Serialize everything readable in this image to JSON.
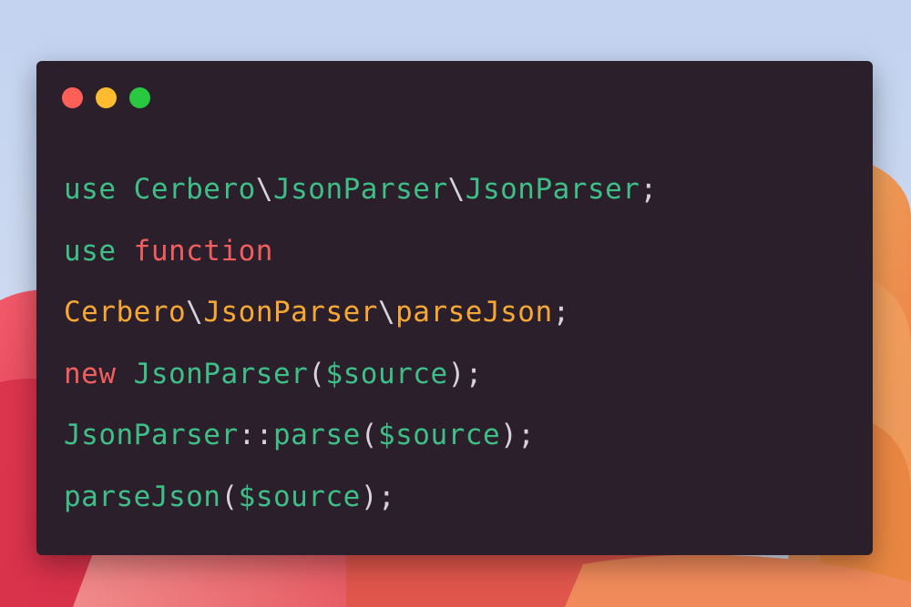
{
  "window": {
    "background": "#2b1f2c",
    "traffic_lights": [
      {
        "name": "close",
        "color": "#ff5f57"
      },
      {
        "name": "minimize",
        "color": "#febc2e"
      },
      {
        "name": "zoom",
        "color": "#28c840"
      }
    ]
  },
  "colors": {
    "keyword": "#3ebf86",
    "namespace": "#3ebf86",
    "function_keyword": "#f05e5e",
    "import_path": "#f7a833",
    "new_keyword": "#f05e5e",
    "variable": "#3ebf86",
    "punctuation": "#d8d2dc"
  },
  "code": {
    "lines": [
      [
        {
          "text": "use ",
          "color": "#3ebf86"
        },
        {
          "text": "Cerbero",
          "color": "#3ebf86"
        },
        {
          "text": "\\",
          "color": "#d8d2dc"
        },
        {
          "text": "JsonParser",
          "color": "#3ebf86"
        },
        {
          "text": "\\",
          "color": "#d8d2dc"
        },
        {
          "text": "JsonParser",
          "color": "#3ebf86"
        },
        {
          "text": ";",
          "color": "#d8d2dc"
        }
      ],
      [
        {
          "text": "use ",
          "color": "#3ebf86"
        },
        {
          "text": "function",
          "color": "#f05e5e"
        }
      ],
      [
        {
          "text": "Cerbero",
          "color": "#f7a833"
        },
        {
          "text": "\\",
          "color": "#d8d2dc"
        },
        {
          "text": "JsonParser",
          "color": "#f7a833"
        },
        {
          "text": "\\",
          "color": "#d8d2dc"
        },
        {
          "text": "parseJson",
          "color": "#f7a833"
        },
        {
          "text": ";",
          "color": "#d8d2dc"
        }
      ],
      [
        {
          "text": "new ",
          "color": "#f05e5e"
        },
        {
          "text": "JsonParser",
          "color": "#3ebf86"
        },
        {
          "text": "(",
          "color": "#d8d2dc"
        },
        {
          "text": "$source",
          "color": "#3ebf86"
        },
        {
          "text": ");",
          "color": "#d8d2dc"
        }
      ],
      [
        {
          "text": "JsonParser",
          "color": "#3ebf86"
        },
        {
          "text": "::",
          "color": "#d8d2dc"
        },
        {
          "text": "parse",
          "color": "#3ebf86"
        },
        {
          "text": "(",
          "color": "#d8d2dc"
        },
        {
          "text": "$source",
          "color": "#3ebf86"
        },
        {
          "text": ");",
          "color": "#d8d2dc"
        }
      ],
      [
        {
          "text": "parseJson",
          "color": "#3ebf86"
        },
        {
          "text": "(",
          "color": "#d8d2dc"
        },
        {
          "text": "$source",
          "color": "#3ebf86"
        },
        {
          "text": ");",
          "color": "#d8d2dc"
        }
      ]
    ]
  }
}
